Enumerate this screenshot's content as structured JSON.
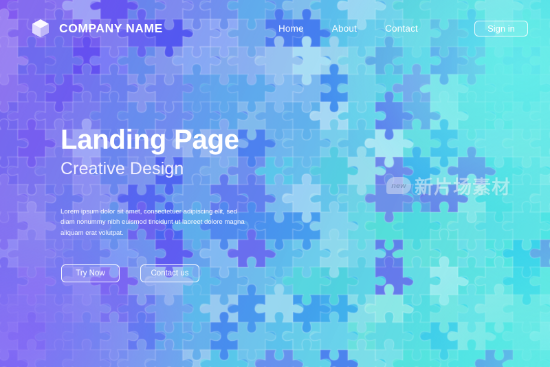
{
  "header": {
    "logo_icon": "cube-icon",
    "brand_name": "COMPANY NAME",
    "nav": [
      {
        "label": "Home"
      },
      {
        "label": "About"
      },
      {
        "label": "Contact"
      }
    ],
    "signin_label": "Sign in"
  },
  "hero": {
    "title": "Landing Page",
    "subtitle": "Creative Design",
    "body": "Lorem ipsum dolor sit amet, consectetuer adipiscing elit, sed diam nonummy nibh euismod tincidunt ut laoreet dolore magna aliquam erat volutpat.",
    "primary_button": "Try Now",
    "secondary_button": "Contact us"
  },
  "watermark": {
    "badge": "new",
    "text": "新片场素材"
  },
  "theme": {
    "gradient_start": "#8a63f0",
    "gradient_mid": "#54a8ee",
    "gradient_end": "#52e9e4",
    "text_color": "#ffffff",
    "purple_accent": "#6a3ff0",
    "cyan_accent": "#3fd4ea"
  },
  "background": {
    "pattern": "jigsaw-puzzle-pieces",
    "cell_size": 40,
    "columns": 21,
    "rows": 14
  }
}
